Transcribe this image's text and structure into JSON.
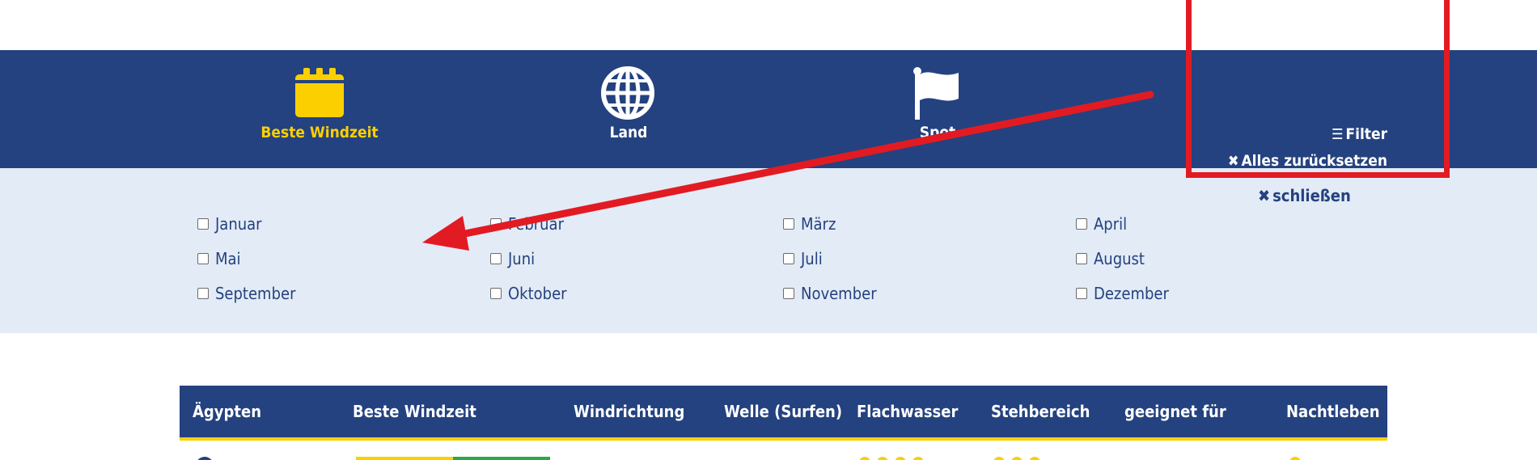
{
  "nav": {
    "best_windzeit": "Beste Windzeit",
    "land": "Land",
    "spot": "Spot"
  },
  "filter": {
    "filter_label": "Filter",
    "reset_label": "Alles zurücksetzen",
    "filter_icon": "sliders-icon",
    "reset_icon": "close-icon"
  },
  "panel": {
    "close_label": "schließen",
    "months": [
      "Januar",
      "Februar",
      "März",
      "April",
      "Mai",
      "Juni",
      "Juli",
      "August",
      "September",
      "Oktober",
      "November",
      "Dezember"
    ]
  },
  "table": {
    "headers": [
      "Ägypten",
      "Beste Windzeit",
      "Windrichtung",
      "Welle (Surfen)",
      "Flachwasser",
      "Stehbereich",
      "geeignet für",
      "Nachtleben"
    ]
  },
  "colors": {
    "navy": "#24427f",
    "yellow": "#fcd000",
    "panel_bg": "#e3ebf6",
    "annotation_red": "#e21b23"
  }
}
